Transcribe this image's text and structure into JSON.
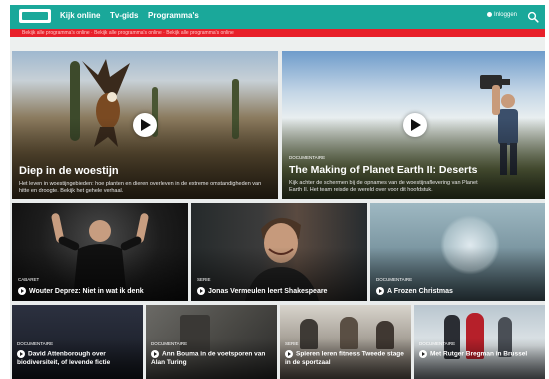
{
  "nav": {
    "items": [
      "Kijk online",
      "Tv-gids",
      "Programma's"
    ],
    "right_link": "Inloggen"
  },
  "banner": {
    "text": "Bekijk alle programma's online  ·  Bekijk alle programma's online  ·  Bekijk alle programma's online"
  },
  "colors": {
    "topbar": "#1aa89a",
    "banner": "#e8202a"
  },
  "featured": [
    {
      "title": "Diep in de woestijn",
      "label": "",
      "description": "Het leven in woestijngebieden: hoe planten en dieren overleven in de extreme omstandigheden van hitte en droogte. Bekijk het gehele verhaal."
    },
    {
      "title": "The Making of Planet Earth II: Deserts",
      "label": "DOCUMENTAIRE",
      "description": "Kijk achter de schermen bij de opnames van de woestijnaflevering van Planet Earth II. Het team reisde de wereld over voor dit hoofdstuk."
    }
  ],
  "row2": [
    {
      "title": "Wouter Deprez: Niet in wat ik denk",
      "label": "CABARET"
    },
    {
      "title": "Jonas Vermeulen leert Shakespeare",
      "label": "SERIE"
    },
    {
      "title": "A Frozen Christmas",
      "label": "DOCUMENTAIRE"
    }
  ],
  "row3": [
    {
      "title": "David Attenborough over biodiversiteit, of levende fictie",
      "label": "DOCUMENTAIRE"
    },
    {
      "title": "Ann Bouma in de voetsporen van Alan Turing",
      "label": "DOCUMENTAIRE"
    },
    {
      "title": "Spieren leren fitness Tweede stage in de sportzaal",
      "label": "SERIE"
    },
    {
      "title": "Met Rutger Bregman in Brussel",
      "label": "DOCUMENTAIRE"
    }
  ]
}
